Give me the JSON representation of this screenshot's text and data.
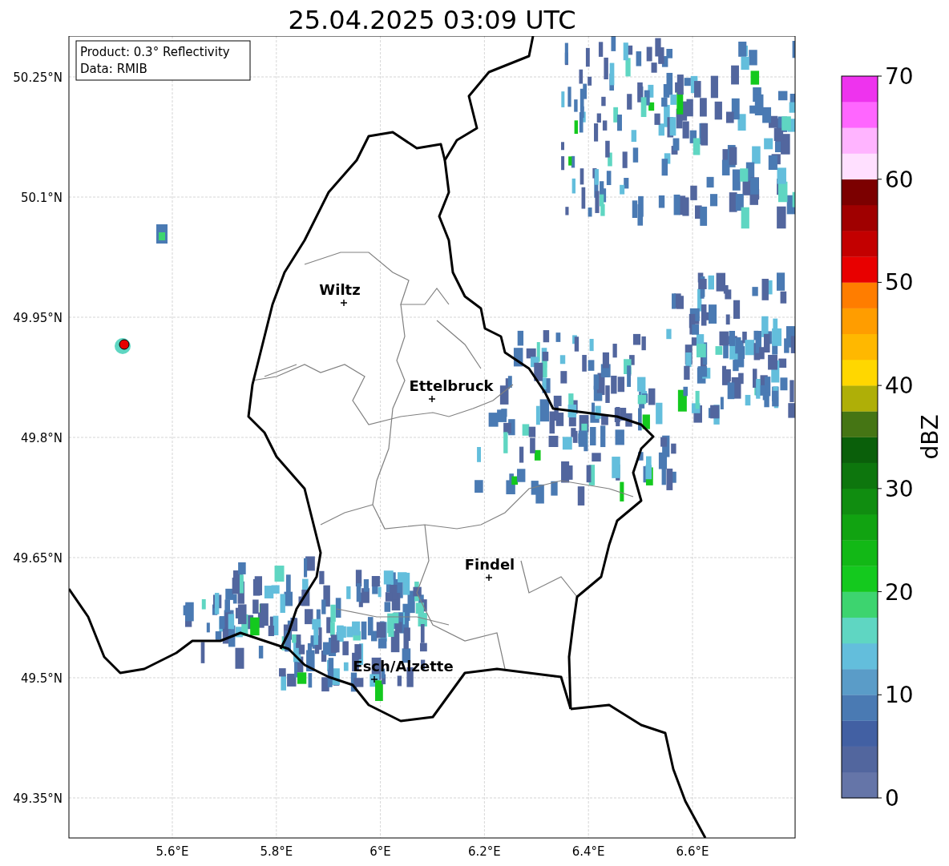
{
  "title": "25.04.2025 03:09 UTC",
  "info": [
    "Product: 0.3° Reflectivity",
    "Data: RMIB"
  ],
  "map": {
    "y_ticks": [
      "50.25°N",
      "50.1°N",
      "49.95°N",
      "49.8°N",
      "49.65°N",
      "49.5°N",
      "49.35°N"
    ],
    "x_ticks": [
      "5.6°E",
      "5.8°E",
      "6°E",
      "6.2°E",
      "6.4°E",
      "6.6°E"
    ],
    "cities": [
      "Wiltz",
      "Ettelbruck",
      "Findel",
      "Esch/Alzette"
    ]
  },
  "colorbar": {
    "label": "dBZ",
    "ticks": [
      "70",
      "60",
      "50",
      "40",
      "30",
      "20",
      "10",
      "0"
    ],
    "segments": [
      {
        "color": "#6575a8"
      },
      {
        "color": "#52669e"
      },
      {
        "color": "#4260a3"
      },
      {
        "color": "#4a7ab3"
      },
      {
        "color": "#5a9cc8"
      },
      {
        "color": "#63bedc"
      },
      {
        "color": "#5fd6c2"
      },
      {
        "color": "#3dd46f"
      },
      {
        "color": "#14c91e"
      },
      {
        "color": "#12b816"
      },
      {
        "color": "#11a311"
      },
      {
        "color": "#108d10"
      },
      {
        "color": "#0d760d"
      },
      {
        "color": "#0a5f0a"
      },
      {
        "color": "#457514"
      },
      {
        "color": "#afaf07"
      },
      {
        "color": "#ffd700"
      },
      {
        "color": "#ffb800"
      },
      {
        "color": "#ff9d00"
      },
      {
        "color": "#ff7d00"
      },
      {
        "color": "#e80000"
      },
      {
        "color": "#c30000"
      },
      {
        "color": "#a00000"
      },
      {
        "color": "#7c0000"
      },
      {
        "color": "#ffe0ff"
      },
      {
        "color": "#ffb4ff"
      },
      {
        "color": "#ff66ff"
      },
      {
        "color": "#ee33ee"
      }
    ]
  }
}
